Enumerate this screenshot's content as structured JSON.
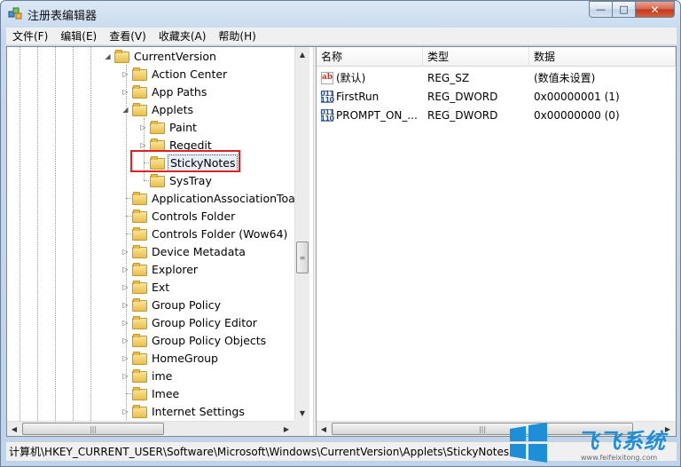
{
  "window": {
    "title": "注册表编辑器",
    "minimize_glyph": "—",
    "maximize_glyph": "□",
    "close_glyph": "✕"
  },
  "menu": [
    "文件(F)",
    "编辑(E)",
    "查看(V)",
    "收藏夹(A)",
    "帮助(H)"
  ],
  "tree": {
    "items": [
      {
        "label": "CurrentVersion",
        "expanded": true
      },
      {
        "label": "Action Center",
        "expanded": false
      },
      {
        "label": "App Paths",
        "expanded": false
      },
      {
        "label": "Applets",
        "expanded": true
      },
      {
        "label": "Paint",
        "expanded": false
      },
      {
        "label": "Regedit",
        "expanded": false
      },
      {
        "label": "StickyNotes",
        "selected": true
      },
      {
        "label": "SysTray"
      },
      {
        "label": "ApplicationAssociationToast"
      },
      {
        "label": "Controls Folder"
      },
      {
        "label": "Controls Folder (Wow64)"
      },
      {
        "label": "Device Metadata",
        "expanded": false
      },
      {
        "label": "Explorer",
        "expanded": false
      },
      {
        "label": "Ext",
        "expanded": false
      },
      {
        "label": "Group Policy",
        "expanded": false
      },
      {
        "label": "Group Policy Editor",
        "expanded": false
      },
      {
        "label": "Group Policy Objects",
        "expanded": false
      },
      {
        "label": "HomeGroup",
        "expanded": false
      },
      {
        "label": "ime",
        "expanded": false
      },
      {
        "label": "Imee"
      },
      {
        "label": "Internet Settings",
        "expanded": false
      }
    ]
  },
  "list": {
    "columns": [
      "名称",
      "类型",
      "数据"
    ],
    "rows": [
      {
        "icon": "string-value-icon",
        "icon_text": "ab",
        "name": "(默认)",
        "type": "REG_SZ",
        "data": "(数值未设置)"
      },
      {
        "icon": "dword-value-icon",
        "icon_text": "011\n110",
        "name": "FirstRun",
        "type": "REG_DWORD",
        "data": "0x00000001 (1)"
      },
      {
        "icon": "dword-value-icon",
        "icon_text": "011\n110",
        "name": "PROMPT_ON_...",
        "type": "REG_DWORD",
        "data": "0x00000000 (0)"
      }
    ]
  },
  "status_bar": {
    "path": "计算机\\HKEY_CURRENT_USER\\Software\\Microsoft\\Windows\\CurrentVersion\\Applets\\StickyNotes"
  },
  "watermark": {
    "text": "飞飞系统",
    "url": "www.feifeixitong.com"
  },
  "colors": {
    "highlight_box": "#dd2222",
    "watermark_blue": "#1e8fd6"
  }
}
